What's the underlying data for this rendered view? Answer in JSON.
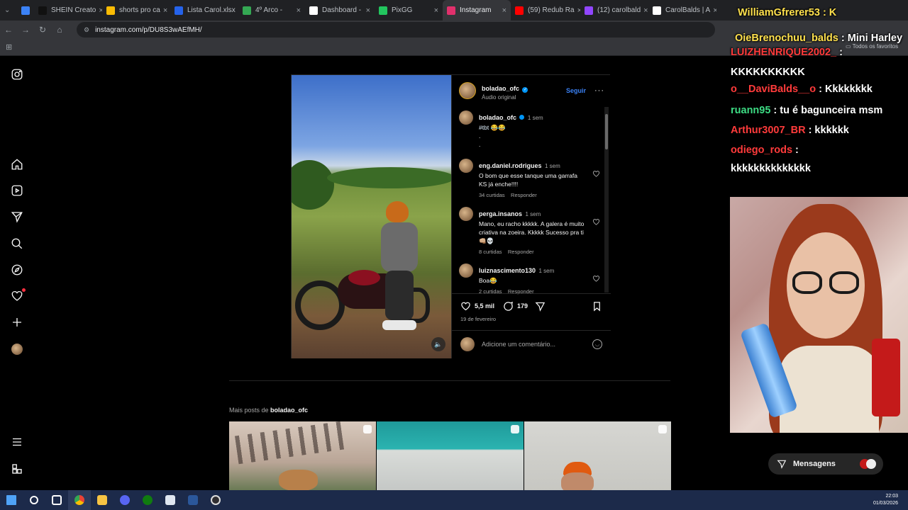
{
  "browser": {
    "tabs": [
      {
        "label": "",
        "color": "#3b82f6"
      },
      {
        "label": "SHEIN Creato",
        "color": "#111111"
      },
      {
        "label": "shorts pro ca",
        "color": "#fbbc04"
      },
      {
        "label": "Lista Carol.xlsx",
        "color": "#2563eb"
      },
      {
        "label": "4º Arco -",
        "color": "#34a853"
      },
      {
        "label": "Dashboard -",
        "color": "#ffffff"
      },
      {
        "label": "PixGG",
        "color": "#22c55e"
      },
      {
        "label": "Instagram",
        "color": "#e1306c",
        "active": true
      },
      {
        "label": "(59) Redub Ra",
        "color": "#ff0000"
      },
      {
        "label": "(12) carolbald",
        "color": "#9146ff"
      },
      {
        "label": "CarolBalds | A",
        "color": "#ffffff"
      }
    ],
    "url": "instagram.com/p/DU8S3wAEfMH/",
    "bookmarks_right": "Todos os favoritos"
  },
  "post": {
    "author": "boladao_ofc",
    "audio": "Áudio original",
    "follow_label": "Seguir",
    "caption_user": "boladao_ofc",
    "caption_time": "1 sem",
    "caption_tag": "#tbt 😂😂",
    "caption_dots": ".\n.",
    "comments": [
      {
        "user": "eng.daniel.rodrigues",
        "time": "1 sem",
        "text": "O bom que esse tanque uma garrafa KS já enche!!!!",
        "likes": "34 curtidas",
        "reply": "Responder"
      },
      {
        "user": "perga.insanos",
        "time": "1 sem",
        "text": "Mano, eu racho kkkkk. A galera é muito criativa na zoeira. Kkkkk Sucesso pra ti 👊🏼💀",
        "likes": "8 curtidas",
        "reply": "Responder"
      },
      {
        "user": "luiznascimento130",
        "time": "1 sem",
        "text": "Boa😂",
        "likes": "2 curtidas",
        "reply": "Responder"
      }
    ],
    "like_count": "5,5 mil",
    "comment_count": "179",
    "date": "19 de fevereiro",
    "add_comment_placeholder": "Adicione um comentário..."
  },
  "more_posts": {
    "prefix": "Mais posts de",
    "user": "boladao_ofc"
  },
  "messages_label": "Mensagens",
  "chat": {
    "top_user": "WilliamGfrerer53 : K",
    "lines": [
      {
        "user": "OieBrenochuu_balds",
        "msg": ": Mini Harley",
        "color": "#ffe14d"
      },
      {
        "user": "LUIZHENRIQUE2002_",
        "msg": ":",
        "color": "#ff3b3b"
      },
      {
        "user": "",
        "msg": "KKKKKKKKKK",
        "color": "#ffffff"
      },
      {
        "user": "o__DaviBalds__o",
        "msg": ": Kkkkkkkk",
        "color": "#ff3b3b"
      },
      {
        "user": "ruann95",
        "msg": ": tu é bagunceira msm",
        "color": "#3ddc84"
      },
      {
        "user": "Arthur3007_BR",
        "msg": ": kkkkkk",
        "color": "#ff3b3b"
      },
      {
        "user": "odiego_rods",
        "msg": ":",
        "color": "#ff3b3b"
      },
      {
        "user": "",
        "msg": "kkkkkkkkkkkkkk",
        "color": "#ffffff"
      }
    ]
  },
  "taskbar": {
    "time": "22:03",
    "date": "01/03/2026"
  }
}
